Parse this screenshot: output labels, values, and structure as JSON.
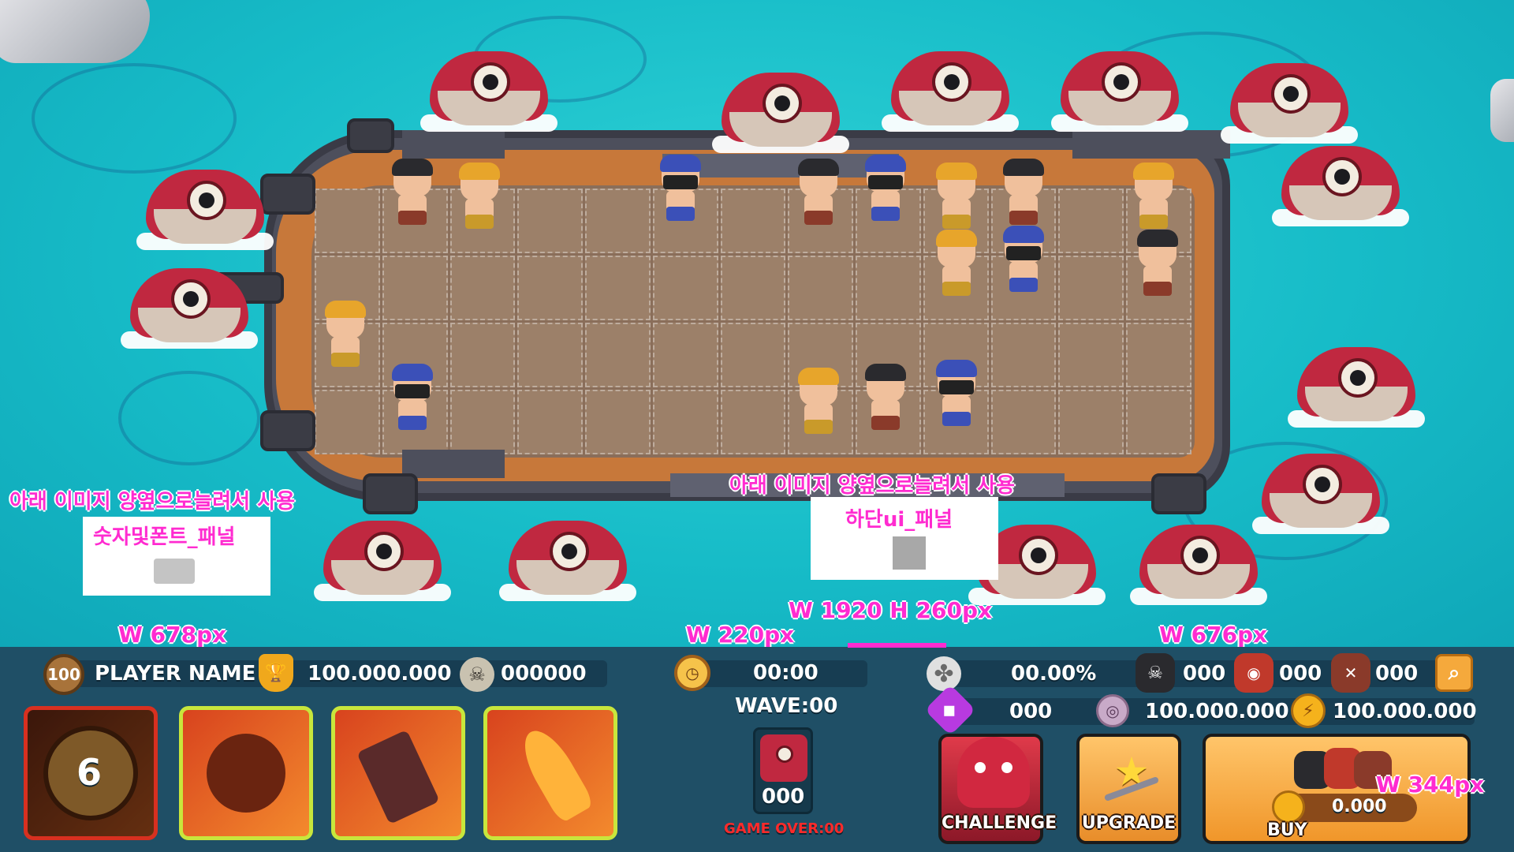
{
  "annotations": {
    "left_note": "아래 이미지 양옆으로늘려서 사용",
    "left_sub": "숫자및폰트_패널",
    "center_note": "아래 이미지 양옆으로늘려서 사용",
    "center_sub": "하단ui_패널",
    "panel_size": "W 1920 H 260px",
    "left_width": "W 678px",
    "mid_width": "W 220px",
    "right_width": "W 676px",
    "buy_width": "W 344px"
  },
  "player": {
    "level": "100",
    "name": "PLAYER NAME",
    "trophy_score": "100.000.000",
    "skull_count": "000000"
  },
  "skills": {
    "cooldown_value": "6"
  },
  "center": {
    "timer": "00:00",
    "wave": "WAVE:00",
    "monster_count": "000",
    "game_over": "GAME OVER:00"
  },
  "stats": {
    "clover_percent": "00.00%",
    "unit1_count": "000",
    "unit2_count": "000",
    "unit3_count": "000",
    "gem_count": "000",
    "silver_coins": "100.000.000",
    "gold_coins": "100.000.000"
  },
  "buttons": {
    "challenge": "CHALLENGE",
    "upgrade": "UPGRADE",
    "buy": "BUY",
    "buy_price": "0.000"
  },
  "colors": {
    "ocean": "#17bcc8",
    "panel": "#1f4f66",
    "annotation": "#ff2bd0",
    "skill_border": "#c8e63c",
    "button_orange": "#f5a93c"
  }
}
